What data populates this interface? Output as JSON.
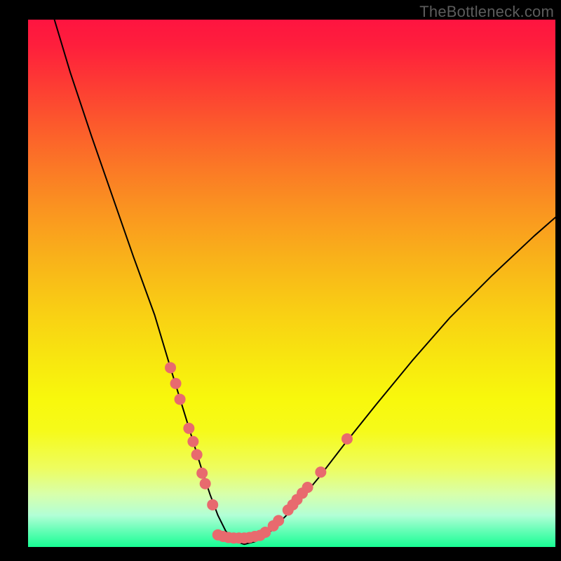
{
  "watermark": "TheBottleneck.com",
  "colors": {
    "frame_bg": "#000000",
    "curve_stroke": "#000000",
    "marker_fill": "#e86a6e",
    "gradient_top": "#fe1440",
    "gradient_bottom": "#18fd94"
  },
  "chart_data": {
    "type": "line",
    "title": "",
    "xlabel": "",
    "ylabel": "",
    "xlim": [
      0,
      100
    ],
    "ylim": [
      0,
      100
    ],
    "grid": false,
    "legend": false,
    "note": "V-shaped bottleneck curve; y≈0 (green) is optimal match, higher y (red) is worse. No numeric tick labels are rendered in the image; x/y values below are estimated from pixel positions on a 0–100 normalized scale.",
    "series": [
      {
        "name": "bottleneck-curve",
        "x": [
          5,
          8,
          12,
          16,
          20,
          24,
          27,
          29,
          31,
          33,
          34.5,
          36,
          37.5,
          39,
          41,
          43,
          46,
          50,
          55,
          60,
          66,
          73,
          80,
          88,
          96,
          100
        ],
        "y": [
          100,
          90,
          78,
          66.5,
          55,
          44,
          34,
          27.5,
          21,
          14.5,
          10,
          6,
          3,
          1.2,
          0.5,
          1,
          3,
          7,
          13,
          19.5,
          27,
          35.5,
          43.5,
          51.5,
          59,
          62.5
        ]
      }
    ],
    "markers": {
      "name": "highlighted-points",
      "note": "Pink dots clustered on both flanks of the curve near the bottom and a dense row along the trough.",
      "points": [
        {
          "x": 27.0,
          "y": 34.0
        },
        {
          "x": 28.0,
          "y": 31.0
        },
        {
          "x": 28.8,
          "y": 28.0
        },
        {
          "x": 30.5,
          "y": 22.5
        },
        {
          "x": 31.3,
          "y": 20.0
        },
        {
          "x": 32.0,
          "y": 17.5
        },
        {
          "x": 33.0,
          "y": 14.0
        },
        {
          "x": 33.6,
          "y": 12.0
        },
        {
          "x": 35.0,
          "y": 8.0
        },
        {
          "x": 36.0,
          "y": 2.3
        },
        {
          "x": 37.0,
          "y": 2.0
        },
        {
          "x": 38.0,
          "y": 1.8
        },
        {
          "x": 39.0,
          "y": 1.7
        },
        {
          "x": 40.0,
          "y": 1.7
        },
        {
          "x": 41.0,
          "y": 1.7
        },
        {
          "x": 42.0,
          "y": 1.8
        },
        {
          "x": 43.0,
          "y": 2.0
        },
        {
          "x": 44.0,
          "y": 2.2
        },
        {
          "x": 45.0,
          "y": 2.8
        },
        {
          "x": 46.5,
          "y": 4.0
        },
        {
          "x": 47.5,
          "y": 5.0
        },
        {
          "x": 49.3,
          "y": 7.0
        },
        {
          "x": 50.2,
          "y": 8.0
        },
        {
          "x": 51.0,
          "y": 9.0
        },
        {
          "x": 52.0,
          "y": 10.2
        },
        {
          "x": 53.0,
          "y": 11.3
        },
        {
          "x": 55.5,
          "y": 14.2
        },
        {
          "x": 60.5,
          "y": 20.5
        }
      ]
    }
  }
}
